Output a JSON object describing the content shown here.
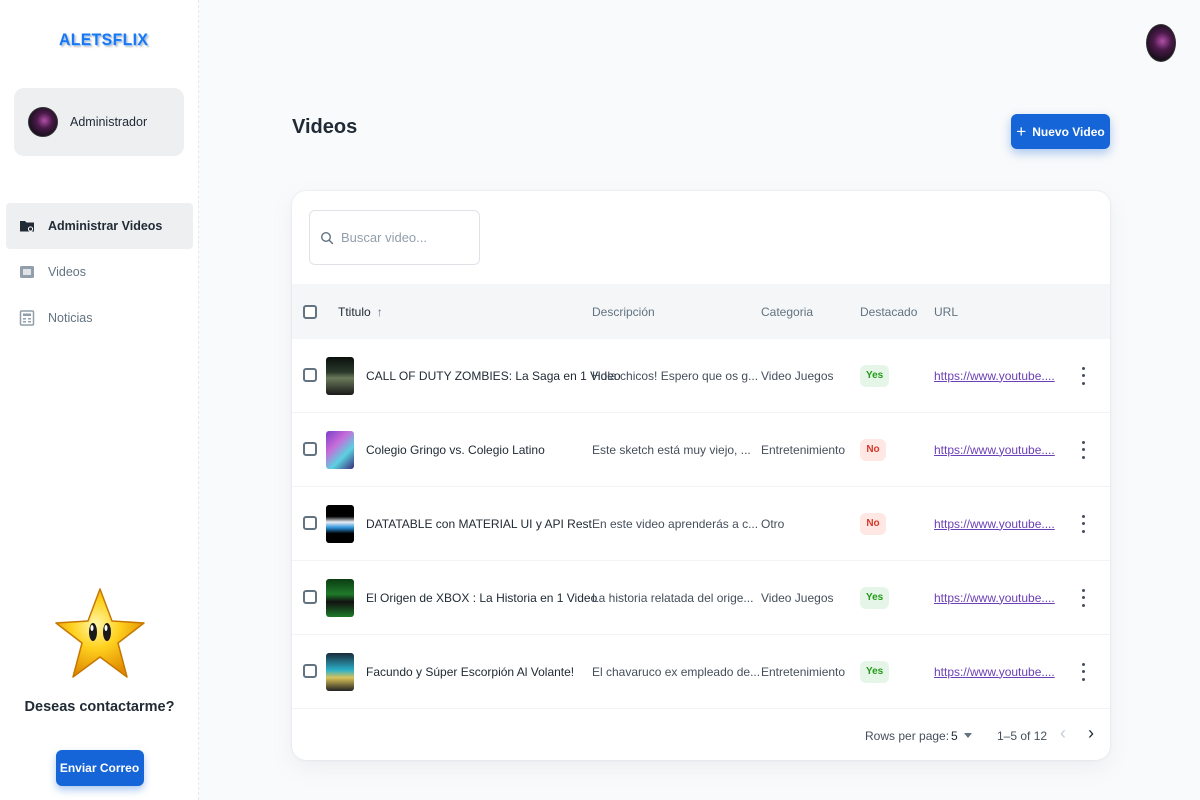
{
  "brand": {
    "logo_text": "ALETSFLIX"
  },
  "account": {
    "name": "Administrador"
  },
  "nav": {
    "items": [
      {
        "label": "Administrar Videos",
        "icon": "folder-icon",
        "active": true
      },
      {
        "label": "Videos",
        "icon": "video-icon",
        "active": false
      },
      {
        "label": "Noticias",
        "icon": "news-icon",
        "active": false
      }
    ]
  },
  "promo": {
    "title": "Deseas contactarme?",
    "button_label": "Enviar Correo",
    "icon": "star-icon"
  },
  "header": {
    "title": "Videos",
    "new_button_label": "Nuevo Video",
    "new_button_icon": "plus-icon"
  },
  "search": {
    "placeholder": "Buscar video...",
    "value": ""
  },
  "table": {
    "columns": [
      "Ttitulo",
      "Descripción",
      "Categoria",
      "Destacado",
      "URL"
    ],
    "sort_indicator": "↑",
    "rows": [
      {
        "title": "CALL OF DUTY ZOMBIES: La Saga en 1 Video",
        "description": "Hola chicos! Espero que os g...",
        "category": "Video Juegos",
        "featured": "Yes",
        "url": "https://www.youtube...."
      },
      {
        "title": "Colegio Gringo vs. Colegio Latino",
        "description": "Este sketch está muy viejo, ...",
        "category": "Entretenimiento",
        "featured": "No",
        "url": "https://www.youtube...."
      },
      {
        "title": "DATATABLE con MATERIAL UI y API Rest",
        "description": "En este video aprenderás a c...",
        "category": "Otro",
        "featured": "No",
        "url": "https://www.youtube...."
      },
      {
        "title": "El Origen de XBOX : La Historia en 1 Video",
        "description": "La historia relatada del orige...",
        "category": "Video Juegos",
        "featured": "Yes",
        "url": "https://www.youtube...."
      },
      {
        "title": "Facundo y Súper Escorpión Al Volante!",
        "description": "El chavaruco ex empleado de...",
        "category": "Entretenimiento",
        "featured": "Yes",
        "url": "https://www.youtube...."
      }
    ]
  },
  "pagination": {
    "rows_per_page_label": "Rows per page:",
    "rows_per_page": "5",
    "range": "1–5 of 12",
    "prev_symbol": "‹",
    "next_symbol": "›"
  },
  "colors": {
    "primary": "#1565d8",
    "yes_badge": "#229a16",
    "no_badge": "#d53a2c",
    "link": "#6b3fb6"
  }
}
